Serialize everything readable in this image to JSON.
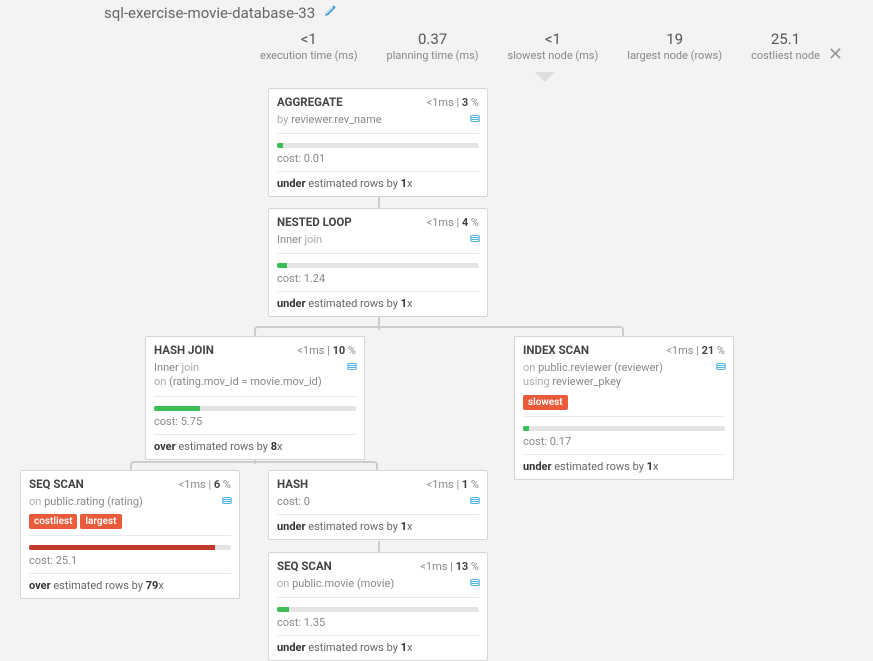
{
  "title": "sql-exercise-movie-database-33",
  "stats": [
    {
      "val": "<1",
      "lbl": "execution time (ms)"
    },
    {
      "val": "0.37",
      "lbl": "planning time (ms)"
    },
    {
      "val": "<1",
      "lbl": "slowest node (ms)"
    },
    {
      "val": "19",
      "lbl": "largest node (rows)"
    },
    {
      "val": "25.1",
      "lbl": "costliest node"
    }
  ],
  "nodes": {
    "aggregate": {
      "name": "AGGREGATE",
      "time": "<1ms",
      "pct": "3",
      "desc_pre": "by ",
      "desc": "reviewer.rev_name",
      "bar_pct": 3,
      "cost": "cost: 0.01",
      "est_dir": "under",
      "est_mid": " estimated rows by ",
      "est_x": "1"
    },
    "nested": {
      "name": "NESTED LOOP",
      "time": "<1ms",
      "pct": "4",
      "desc_pre": "Inner ",
      "desc": "join",
      "bar_pct": 5,
      "cost": "cost: 1.24",
      "est_dir": "under",
      "est_mid": " estimated rows by ",
      "est_x": "1"
    },
    "hashjoin": {
      "name": "HASH JOIN",
      "time": "<1ms",
      "pct": "10",
      "desc_pre": "Inner ",
      "desc": "join",
      "desc2_pre": "on ",
      "desc2": "(rating.mov_id = movie.mov_id)",
      "bar_pct": 23,
      "cost": "cost: 5.75",
      "est_dir": "over",
      "est_mid": " estimated rows by ",
      "est_x": "8"
    },
    "indexscan": {
      "name": "INDEX SCAN",
      "time": "<1ms",
      "pct": "21",
      "desc_pre": "on ",
      "desc": "public.reviewer (reviewer)",
      "desc2_pre": "using ",
      "desc2": "reviewer_pkey",
      "tag1": "slowest",
      "bar_pct": 3,
      "cost": "cost: 0.17",
      "est_dir": "under",
      "est_mid": " estimated rows by ",
      "est_x": "1"
    },
    "seqrating": {
      "name": "SEQ SCAN",
      "time": "<1ms",
      "pct": "6",
      "desc_pre": "on ",
      "desc": "public.rating (rating)",
      "tag1": "costliest",
      "tag2": "largest",
      "bar_pct": 92,
      "cost": "cost: 25.1",
      "est_dir": "over",
      "est_mid": " estimated rows by ",
      "est_x": "79"
    },
    "hash": {
      "name": "HASH",
      "time": "<1ms",
      "pct": "1",
      "cost": "cost: 0",
      "est_dir": "under",
      "est_mid": " estimated rows by ",
      "est_x": "1"
    },
    "seqmovie": {
      "name": "SEQ SCAN",
      "time": "<1ms",
      "pct": "13",
      "desc_pre": "on ",
      "desc": "public.movie (movie)",
      "bar_pct": 6,
      "cost": "cost: 1.35",
      "est_dir": "under",
      "est_mid": " estimated rows by ",
      "est_x": "1"
    }
  },
  "suffix_x": "x",
  "pct_sym": " %",
  "sep": " | "
}
